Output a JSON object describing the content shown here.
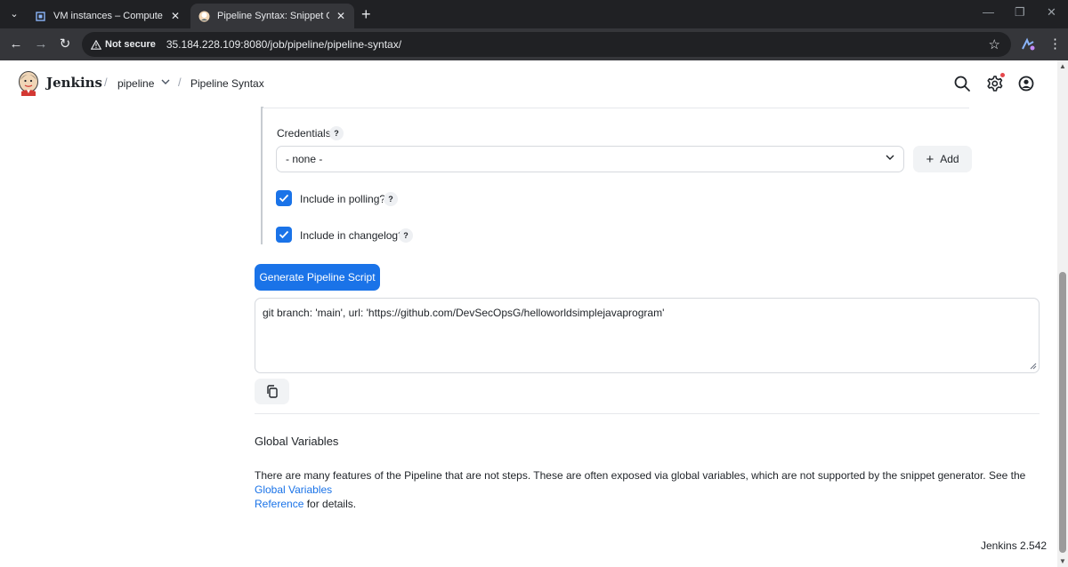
{
  "browser": {
    "tabs": [
      {
        "title": "VM instances – Compute Engin",
        "close": "✕",
        "active": false
      },
      {
        "title": "Pipeline Syntax: Snippet Genera",
        "close": "✕",
        "active": true
      }
    ],
    "new_tab": "+",
    "security_label": "Not secure",
    "url": "35.184.228.109:8080/job/pipeline/pipeline-syntax/"
  },
  "header": {
    "brand": "Jenkins",
    "breadcrumbs": [
      "pipeline",
      "Pipeline Syntax"
    ],
    "separator": "/"
  },
  "form": {
    "credentials_label": "Credentials",
    "help_mark": "?",
    "credentials_value": "- none -",
    "add_label": "Add",
    "include_polling_label": "Include in polling?",
    "include_polling_checked": true,
    "include_changelog_label": "Include in changelog?",
    "include_changelog_checked": true
  },
  "generate_button": "Generate Pipeline Script",
  "generated_script": "git branch: 'main', url: 'https://github.com/DevSecOpsG/helloworldsimplejavaprogram'",
  "global_variables": {
    "title": "Global Variables",
    "text_before": "There are many features of the Pipeline that are not steps. These are often exposed via global variables, which are not supported by the snippet generator. See the ",
    "link_part1": "Global Variables",
    "link_part2": "Reference",
    "text_after": " for details."
  },
  "footer": {
    "version": "Jenkins 2.542"
  },
  "colors": {
    "accent": "#1a73e8",
    "chrome_dark": "#202124",
    "chrome_toolbar": "#35363a"
  }
}
